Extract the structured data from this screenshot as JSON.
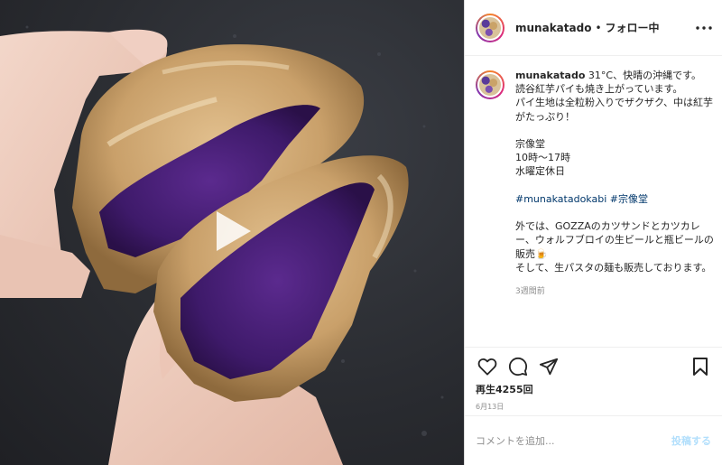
{
  "header": {
    "username": "munakatado",
    "separator": "•",
    "follow_status": "フォロー中",
    "more_icon": "more-horizontal-icon"
  },
  "media": {
    "play_icon": "play-icon"
  },
  "caption": {
    "username": "munakatado",
    "lines": [
      "31°C、快晴の沖縄です。",
      "読谷紅芋パイも焼き上がっています。",
      "パイ生地は全粒粉入りでザクザク、中は紅芋がたっぷり！",
      "",
      "宗像堂",
      "10時〜17時",
      "水曜定休日",
      "",
      "外では、GOZZAのカツサンドとカツカレー、ウォルフブロイの生ビールと瓶ビールの販売🍺",
      "そして、生パスタの麺も販売しております。"
    ],
    "hashtags": [
      "#munakatadokabi",
      "#宗像堂"
    ],
    "time_ago": "3週間前"
  },
  "actions": {
    "like_icon": "heart-icon",
    "comment_icon": "comment-icon",
    "share_icon": "share-icon",
    "save_icon": "bookmark-icon",
    "views": "再生4255回",
    "date": "6月13日"
  },
  "comment": {
    "placeholder": "コメントを追加...",
    "post_label": "投稿する"
  },
  "colors": {
    "link": "#00376b",
    "post_disabled": "#b2dffc",
    "muted": "#8e8e8e"
  }
}
